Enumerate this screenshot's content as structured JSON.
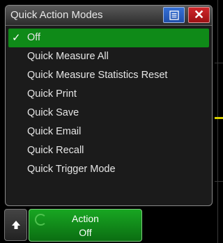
{
  "dialog": {
    "title": "Quick Action Modes",
    "menu_icon": "menu-icon",
    "close_icon": "close-icon",
    "close_glyph": "✕",
    "items": [
      {
        "label": "Off",
        "selected": true
      },
      {
        "label": "Quick Measure All",
        "selected": false
      },
      {
        "label": "Quick Measure Statistics Reset",
        "selected": false
      },
      {
        "label": "Quick Print",
        "selected": false
      },
      {
        "label": "Quick Save",
        "selected": false
      },
      {
        "label": "Quick Email",
        "selected": false
      },
      {
        "label": "Quick Recall",
        "selected": false
      },
      {
        "label": "Quick Trigger Mode",
        "selected": false
      }
    ],
    "check_glyph": "✓"
  },
  "softkeys": {
    "up_icon": "up-arrow-icon",
    "action": {
      "label": "Action",
      "value": "Off"
    }
  },
  "colors": {
    "selected": "#0f8a18",
    "menu_button": "#2a5fc0",
    "close_button": "#c0191d",
    "trace": "#d8d000"
  }
}
